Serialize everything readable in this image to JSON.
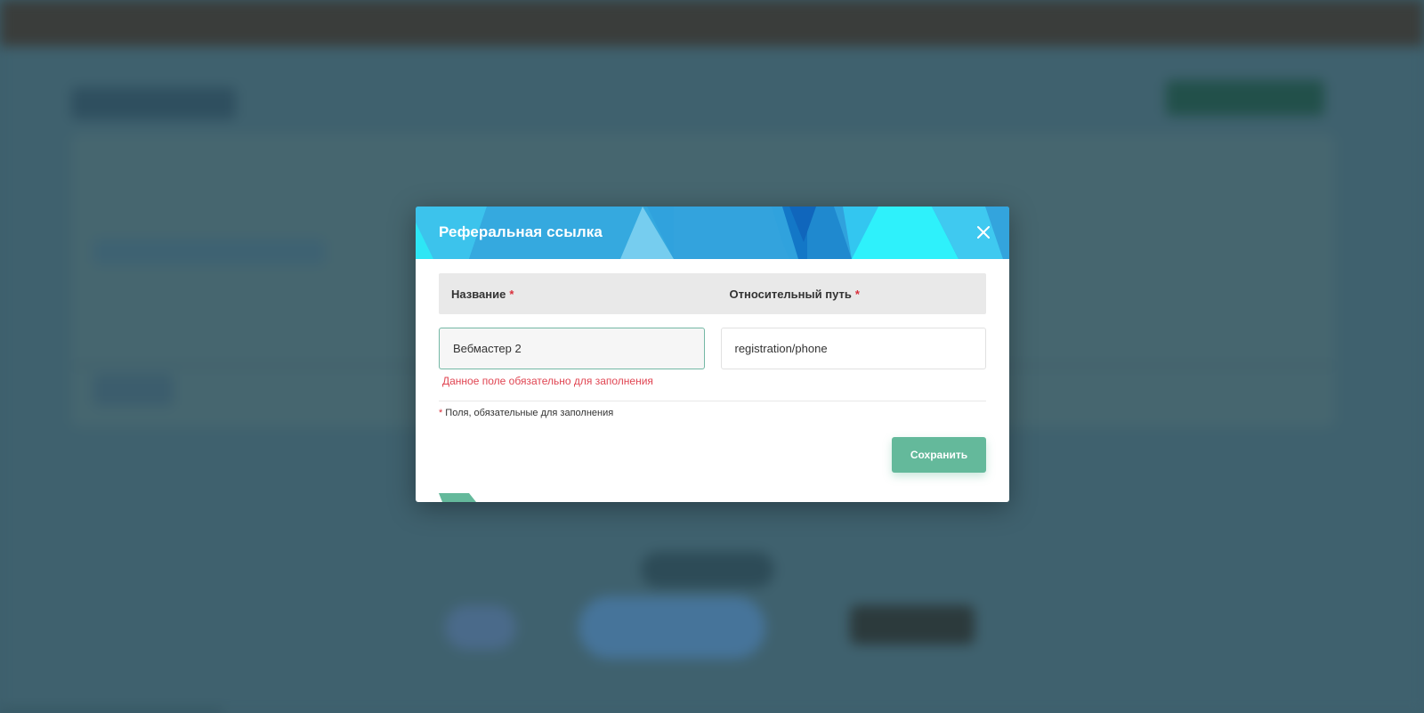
{
  "modal": {
    "title": "Реферальная ссылка",
    "columns": {
      "name_label": "Название",
      "path_label": "Относительный путь",
      "required_mark": "*"
    },
    "name_field": {
      "value": "Вебмастер 2",
      "error": "Данное поле обязательно для заполнения"
    },
    "path_field": {
      "value": "registration/phone"
    },
    "required_note": "Поля, обязательные для заполнения",
    "save_label": "Сохранить"
  },
  "icons": {
    "close": "close-icon"
  },
  "colors": {
    "header_blue": "#30a2dd",
    "header_cyan": "#2ef1fb",
    "save_green": "#64b99b",
    "error_red": "#e04552",
    "required_red": "#d9303c"
  }
}
